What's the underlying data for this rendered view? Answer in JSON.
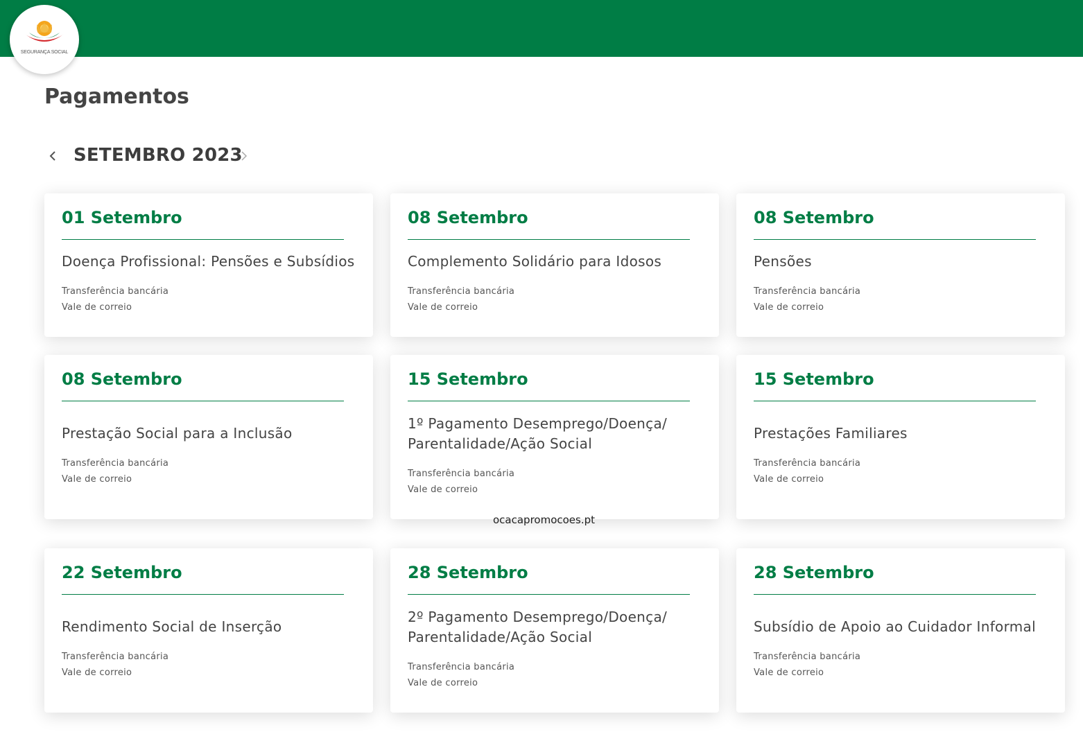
{
  "brand": {
    "logo_text": "SEGURANÇA SOCIAL",
    "header_color": "#007d45",
    "accent_color": "#007d45"
  },
  "page": {
    "title": "Pagamentos"
  },
  "month_nav": {
    "label": "SETEMBRO 2023",
    "prev_icon": "chevron-left-icon",
    "next_icon": "chevron-right-icon"
  },
  "cards": [
    {
      "date": "01 Setembro",
      "title_lines": [
        "Doença Profissional: Pensões e Subsídios"
      ],
      "methods": [
        "Transferência bancária",
        "Vale de correio"
      ]
    },
    {
      "date": "08 Setembro",
      "title_lines": [
        "Complemento Solidário para Idosos"
      ],
      "methods": [
        "Transferência bancária",
        "Vale de correio"
      ]
    },
    {
      "date": "08 Setembro",
      "title_lines": [
        "Pensões"
      ],
      "methods": [
        "Transferência bancária",
        "Vale de correio"
      ]
    },
    {
      "date": "08 Setembro",
      "title_lines": [
        "Prestação Social para a Inclusão"
      ],
      "methods": [
        "Transferência bancária",
        "Vale de correio"
      ]
    },
    {
      "date": "15 Setembro",
      "title_lines": [
        "1º Pagamento Desemprego/Doença/",
        "Parentalidade/Ação Social"
      ],
      "methods": [
        "Transferência bancária",
        "Vale de correio"
      ]
    },
    {
      "date": "15 Setembro",
      "title_lines": [
        "Prestações Familiares"
      ],
      "methods": [
        "Transferência bancária",
        "Vale de correio"
      ]
    },
    {
      "date": "22 Setembro",
      "title_lines": [
        "Rendimento Social de Inserção"
      ],
      "methods": [
        "Transferência bancária",
        "Vale de correio"
      ]
    },
    {
      "date": "28 Setembro",
      "title_lines": [
        "2º Pagamento Desemprego/Doença/",
        "Parentalidade/Ação Social"
      ],
      "methods": [
        "Transferência bancária",
        "Vale de correio"
      ]
    },
    {
      "date": "28 Setembro",
      "title_lines": [
        "Subsídio de Apoio ao Cuidador Informal"
      ],
      "methods": [
        "Transferência bancária",
        "Vale de correio"
      ]
    }
  ],
  "watermark": "ocacapromocoes.pt"
}
